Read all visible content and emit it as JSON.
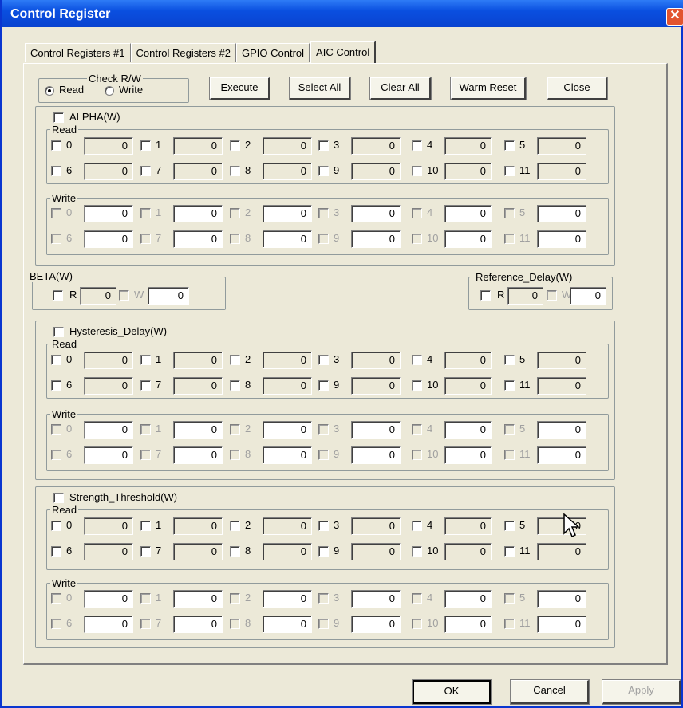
{
  "window": {
    "title": "Control Register",
    "close_glyph": "✕"
  },
  "tabs": [
    "Control  Registers #1",
    "Control Registers #2",
    "GPIO Control",
    "AIC Control"
  ],
  "active_tab": 3,
  "checkrw": {
    "label": "Check R/W",
    "read": "Read",
    "write": "Write",
    "selected": "read"
  },
  "toolbar": {
    "execute": "Execute",
    "select_all": "Select All",
    "clear_all": "Clear All",
    "warm_reset": "Warm Reset",
    "close": "Close"
  },
  "group_labels": {
    "read": "Read",
    "write": "Write"
  },
  "alpha": {
    "title": "ALPHA(W)",
    "read": [
      [
        "0",
        "0"
      ],
      [
        "1",
        "0"
      ],
      [
        "2",
        "0"
      ],
      [
        "3",
        "0"
      ],
      [
        "4",
        "0"
      ],
      [
        "5",
        "0"
      ],
      [
        "6",
        "0"
      ],
      [
        "7",
        "0"
      ],
      [
        "8",
        "0"
      ],
      [
        "9",
        "0"
      ],
      [
        "10",
        "0"
      ],
      [
        "11",
        "0"
      ]
    ],
    "write": [
      [
        "0",
        "0"
      ],
      [
        "1",
        "0"
      ],
      [
        "2",
        "0"
      ],
      [
        "3",
        "0"
      ],
      [
        "4",
        "0"
      ],
      [
        "5",
        "0"
      ],
      [
        "6",
        "0"
      ],
      [
        "7",
        "0"
      ],
      [
        "8",
        "0"
      ],
      [
        "9",
        "0"
      ],
      [
        "10",
        "0"
      ],
      [
        "11",
        "0"
      ]
    ]
  },
  "beta": {
    "title": "BETA(W)",
    "r_label": "R",
    "r_value": "0",
    "w_label": "W",
    "w_value": "0"
  },
  "refdelay": {
    "title": "Reference_Delay(W)",
    "r_label": "R",
    "r_value": "0",
    "w_label": "W",
    "w_value": "0"
  },
  "hysteresis": {
    "title": "Hysteresis_Delay(W)",
    "read": [
      [
        "0",
        "0"
      ],
      [
        "1",
        "0"
      ],
      [
        "2",
        "0"
      ],
      [
        "3",
        "0"
      ],
      [
        "4",
        "0"
      ],
      [
        "5",
        "0"
      ],
      [
        "6",
        "0"
      ],
      [
        "7",
        "0"
      ],
      [
        "8",
        "0"
      ],
      [
        "9",
        "0"
      ],
      [
        "10",
        "0"
      ],
      [
        "11",
        "0"
      ]
    ],
    "write": [
      [
        "0",
        "0"
      ],
      [
        "1",
        "0"
      ],
      [
        "2",
        "0"
      ],
      [
        "3",
        "0"
      ],
      [
        "4",
        "0"
      ],
      [
        "5",
        "0"
      ],
      [
        "6",
        "0"
      ],
      [
        "7",
        "0"
      ],
      [
        "8",
        "0"
      ],
      [
        "9",
        "0"
      ],
      [
        "10",
        "0"
      ],
      [
        "11",
        "0"
      ]
    ]
  },
  "strength": {
    "title": "Strength_Threshold(W)",
    "read": [
      [
        "0",
        "0"
      ],
      [
        "1",
        "0"
      ],
      [
        "2",
        "0"
      ],
      [
        "3",
        "0"
      ],
      [
        "4",
        "0"
      ],
      [
        "5",
        "0"
      ],
      [
        "6",
        "0"
      ],
      [
        "7",
        "0"
      ],
      [
        "8",
        "0"
      ],
      [
        "9",
        "0"
      ],
      [
        "10",
        "0"
      ],
      [
        "11",
        "0"
      ]
    ],
    "write": [
      [
        "0",
        "0"
      ],
      [
        "1",
        "0"
      ],
      [
        "2",
        "0"
      ],
      [
        "3",
        "0"
      ],
      [
        "4",
        "0"
      ],
      [
        "5",
        "0"
      ],
      [
        "6",
        "0"
      ],
      [
        "7",
        "0"
      ],
      [
        "8",
        "0"
      ],
      [
        "9",
        "0"
      ],
      [
        "10",
        "0"
      ],
      [
        "11",
        "0"
      ]
    ]
  },
  "dialog_buttons": {
    "ok": "OK",
    "cancel": "Cancel",
    "apply": "Apply"
  },
  "colors": {
    "title_bar": "#0a4fe0",
    "face": "#ece9d8",
    "disabled_text": "#a0a0a0"
  }
}
